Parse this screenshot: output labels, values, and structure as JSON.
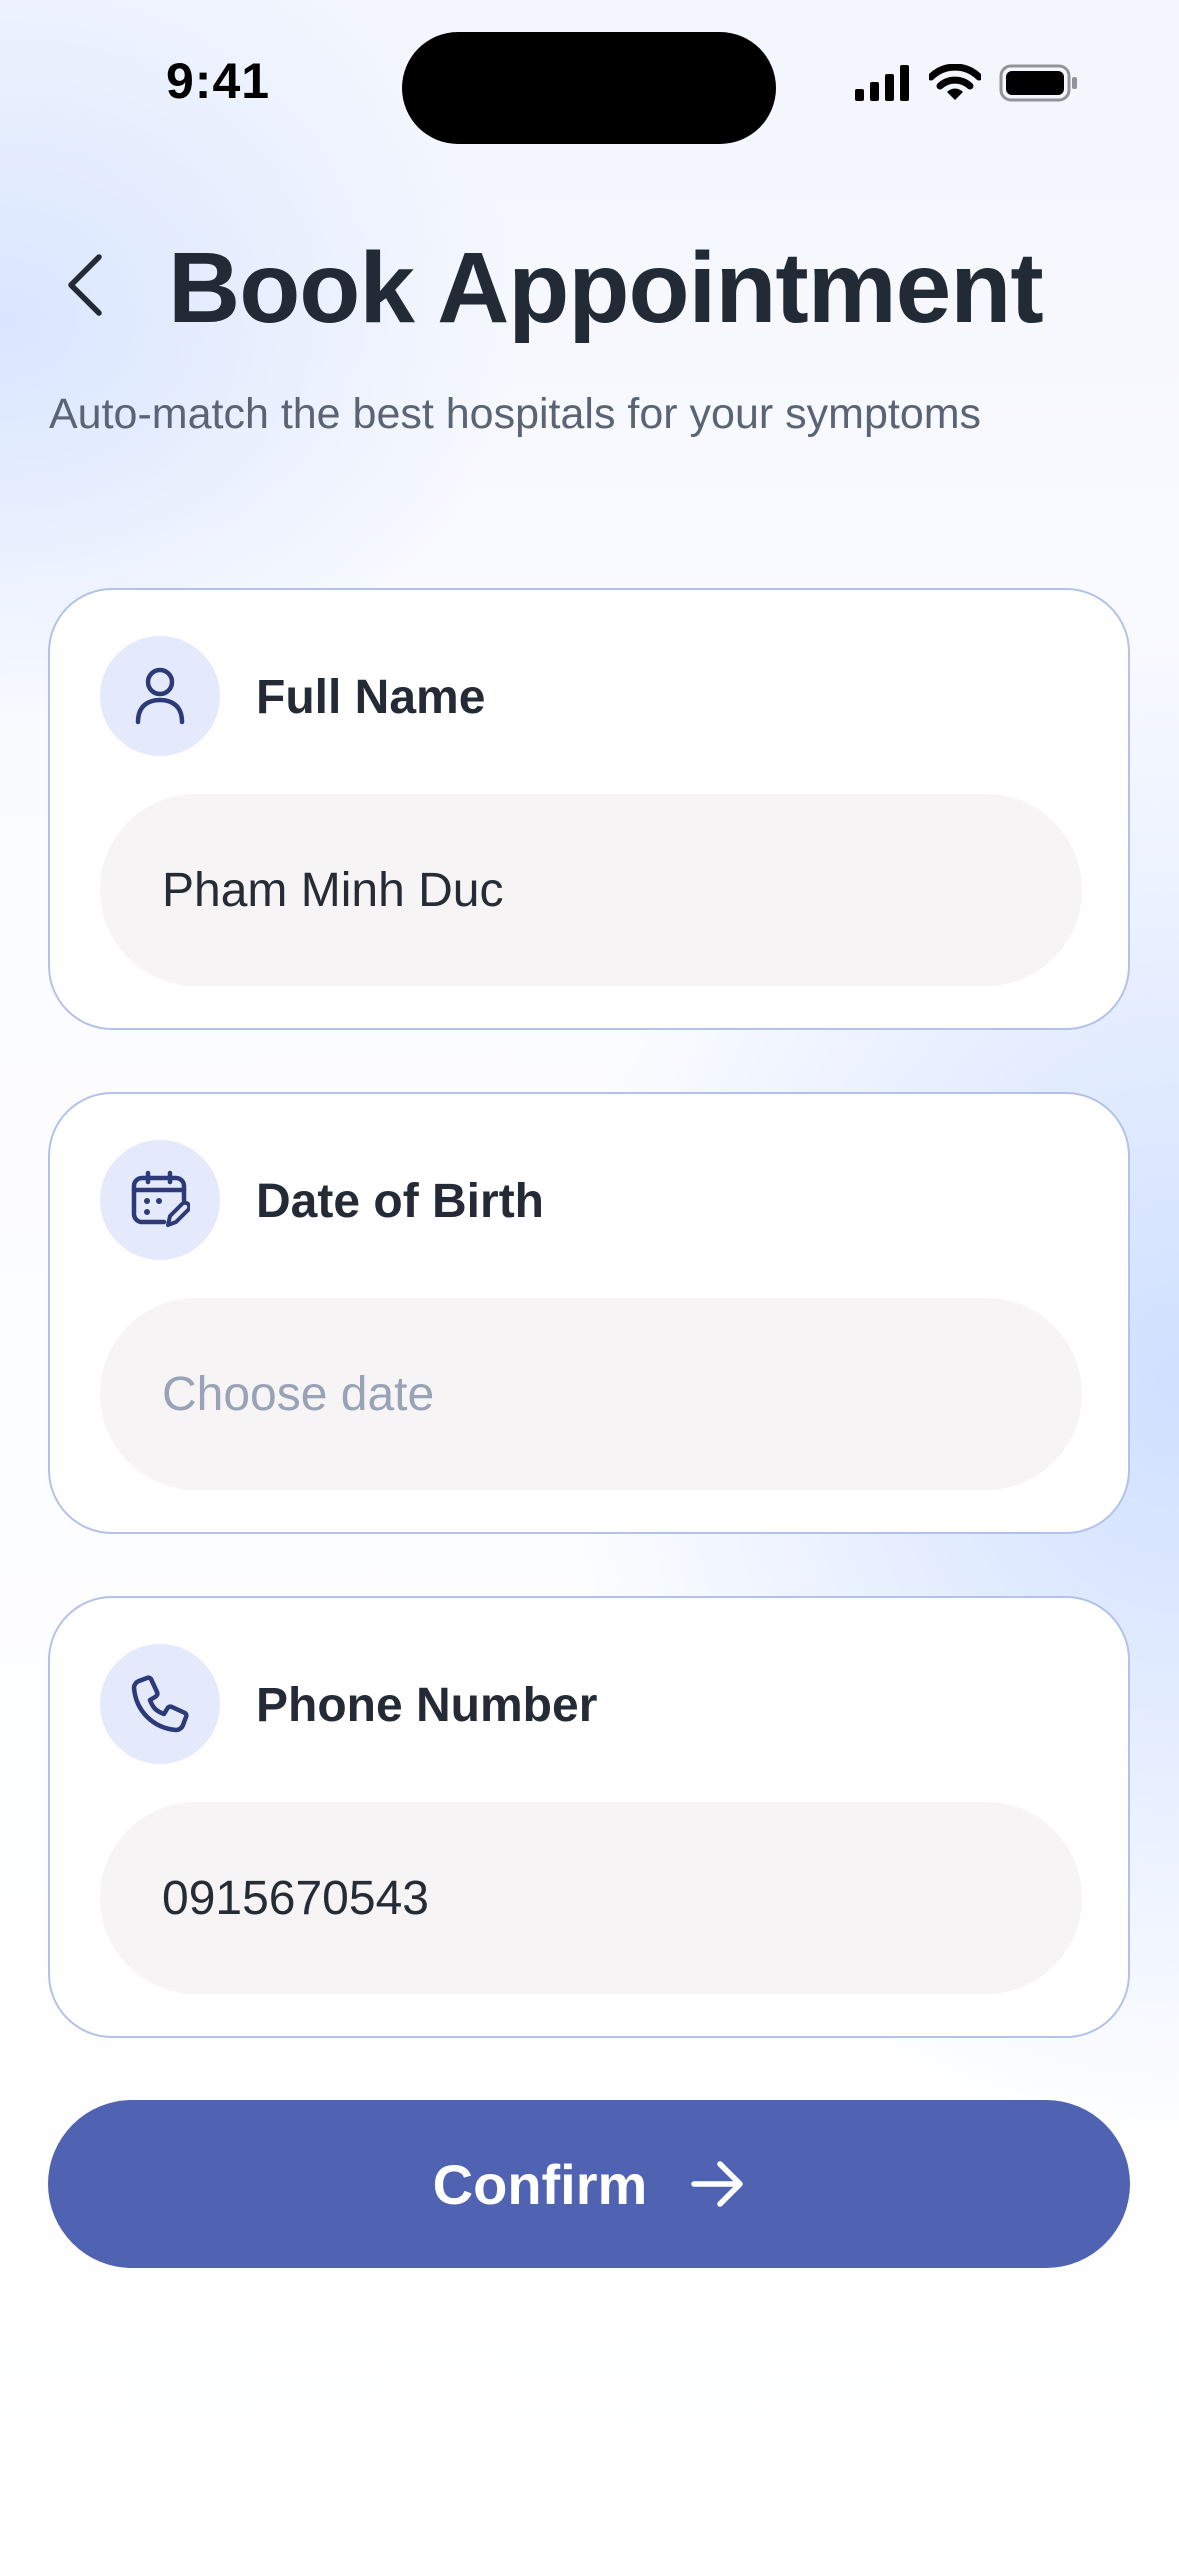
{
  "status_bar": {
    "time": "9:41"
  },
  "header": {
    "title": "Book Appointment",
    "subtitle": "Auto-match the best hospitals for your symptoms",
    "back_icon": "chevron-left-icon"
  },
  "form": {
    "full_name": {
      "label": "Full Name",
      "icon": "user-icon",
      "value": "Pham Minh Duc",
      "placeholder": ""
    },
    "date_of_birth": {
      "label": "Date of Birth",
      "icon": "calendar-edit-icon",
      "value": "",
      "placeholder": "Choose date"
    },
    "phone_number": {
      "label": "Phone Number",
      "icon": "phone-icon",
      "value": "0915670543",
      "placeholder": ""
    }
  },
  "confirm": {
    "label": "Confirm",
    "icon": "arrow-right-icon"
  },
  "colors": {
    "accent": "#4f63b2",
    "card_border": "#b3c2ec",
    "icon_bg": "#e4e9fc",
    "icon_stroke": "#2c3a78",
    "field_bg": "#f6f4f4",
    "title": "#222a35",
    "subtitle": "#5b6475",
    "placeholder": "#98a3b8"
  }
}
